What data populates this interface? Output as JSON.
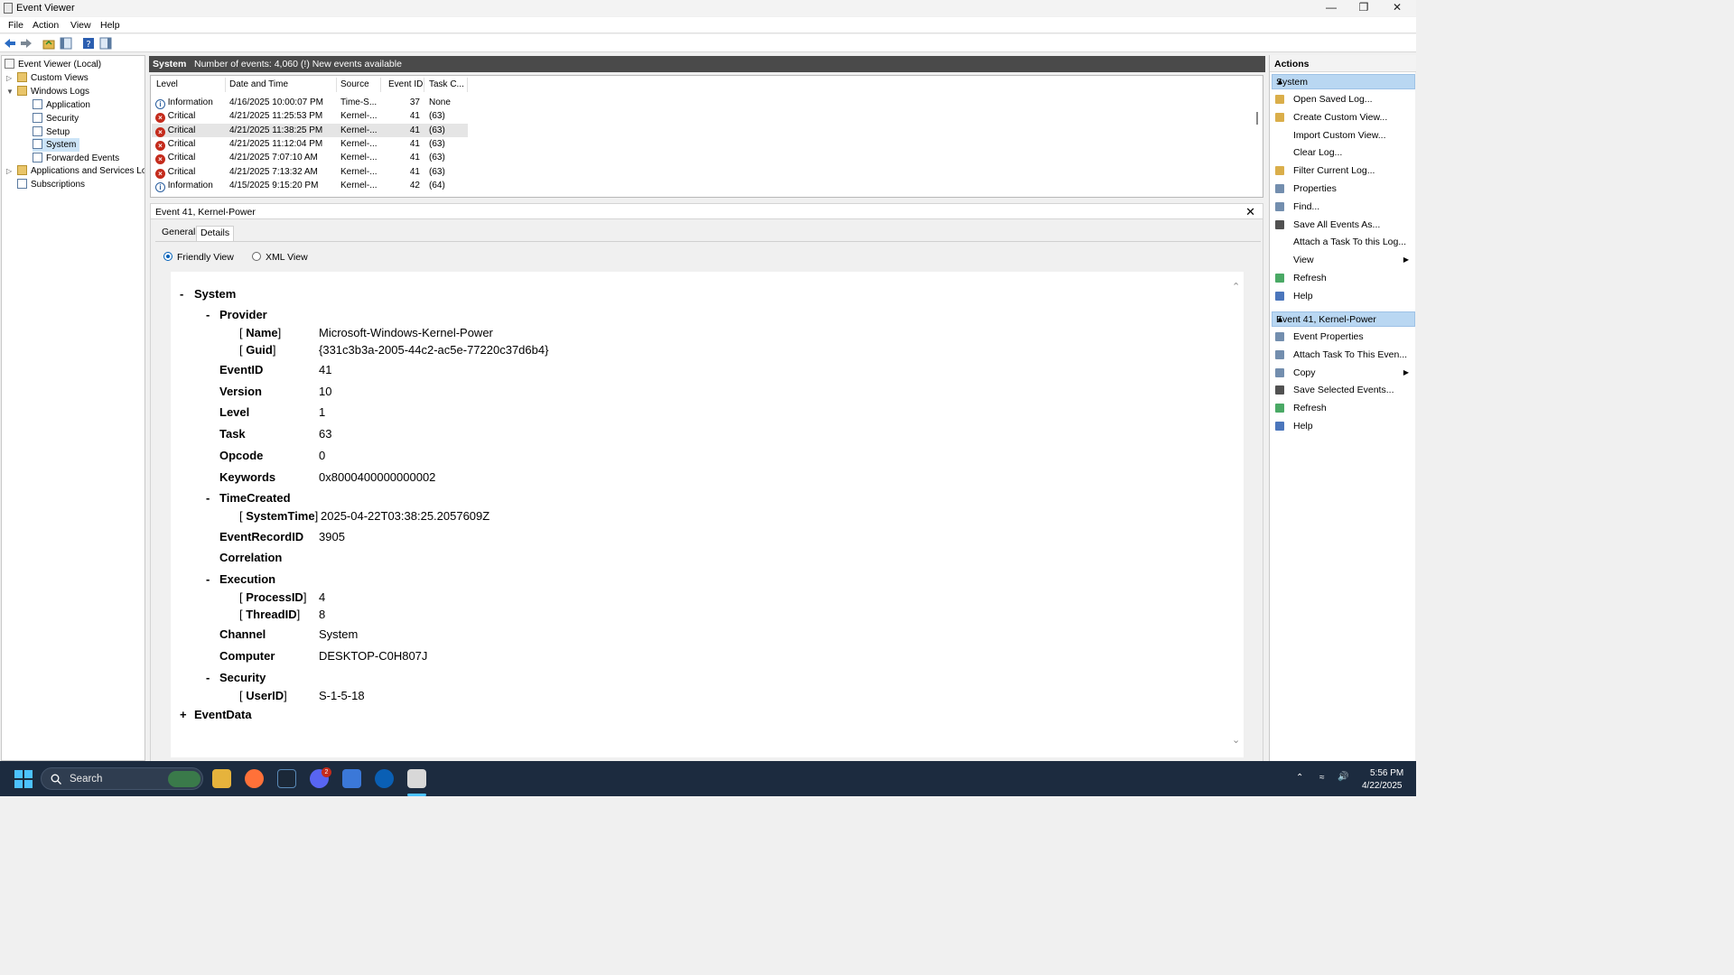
{
  "window": {
    "title": "Event Viewer",
    "controls": {
      "minimize": "—",
      "maximize": "❐",
      "close": "✕"
    }
  },
  "menu": [
    "File",
    "Action",
    "View",
    "Help"
  ],
  "tree": {
    "root": "Event Viewer (Local)",
    "custom_views": "Custom Views",
    "windows_logs": "Windows Logs",
    "logs": [
      "Application",
      "Security",
      "Setup",
      "System",
      "Forwarded Events"
    ],
    "apps_services": "Applications and Services Lo",
    "subscriptions": "Subscriptions"
  },
  "log_header": {
    "name": "System",
    "summary": "Number of events: 4,060 (!) New events available"
  },
  "events": {
    "columns": [
      "Level",
      "Date and Time",
      "Source",
      "Event ID",
      "Task C..."
    ],
    "rows": [
      {
        "level": "Information",
        "date": "4/16/2025 10:00:07 PM",
        "source": "Time-S...",
        "id": "37",
        "task": "None",
        "icon": "info-icon"
      },
      {
        "level": "Critical",
        "date": "4/21/2025 11:25:53 PM",
        "source": "Kernel-...",
        "id": "41",
        "task": "(63)",
        "icon": "critical-icon"
      },
      {
        "level": "Critical",
        "date": "4/21/2025 11:38:25 PM",
        "source": "Kernel-...",
        "id": "41",
        "task": "(63)",
        "icon": "critical-icon"
      },
      {
        "level": "Critical",
        "date": "4/21/2025 11:12:04 PM",
        "source": "Kernel-...",
        "id": "41",
        "task": "(63)",
        "icon": "critical-icon"
      },
      {
        "level": "Critical",
        "date": "4/21/2025 7:07:10 AM",
        "source": "Kernel-...",
        "id": "41",
        "task": "(63)",
        "icon": "critical-icon"
      },
      {
        "level": "Critical",
        "date": "4/21/2025 7:13:32 AM",
        "source": "Kernel-...",
        "id": "41",
        "task": "(63)",
        "icon": "critical-icon"
      },
      {
        "level": "Information",
        "date": "4/15/2025 9:15:20 PM",
        "source": "Kernel-...",
        "id": "42",
        "task": "(64)",
        "icon": "info-icon"
      }
    ]
  },
  "detail": {
    "title": "Event 41, Kernel-Power",
    "close": "✕",
    "tabs": [
      "General",
      "Details"
    ],
    "view_options": [
      "Friendly View",
      "XML View"
    ],
    "system": {
      "section": "System",
      "provider": "Provider",
      "provider_name_label": "Name",
      "provider_name": "Microsoft-Windows-Kernel-Power",
      "provider_guid_label": "Guid",
      "provider_guid": "{331c3b3a-2005-44c2-ac5e-77220c37d6b4}",
      "eventid_label": "EventID",
      "eventid": "41",
      "version_label": "Version",
      "version": "10",
      "level_label": "Level",
      "level": "1",
      "task_label": "Task",
      "task": "63",
      "opcode_label": "Opcode",
      "opcode": "0",
      "keywords_label": "Keywords",
      "keywords": "0x8000400000000002",
      "timecreated": "TimeCreated",
      "systemtime_label": "SystemTime",
      "systemtime": "2025-04-22T03:38:25.2057609Z",
      "eventrecordid_label": "EventRecordID",
      "eventrecordid": "3905",
      "correlation_label": "Correlation",
      "execution": "Execution",
      "processid_label": "ProcessID",
      "processid": "4",
      "threadid_label": "ThreadID",
      "threadid": "8",
      "channel_label": "Channel",
      "channel": "System",
      "computer_label": "Computer",
      "computer": "DESKTOP-C0H807J",
      "security": "Security",
      "userid_label": "UserID",
      "userid": "S-1-5-18"
    },
    "eventdata": "EventData",
    "toggle_minus": "-",
    "toggle_plus": "+"
  },
  "actions": {
    "header": "Actions",
    "section1": "System",
    "items1": [
      {
        "label": "Open Saved Log...",
        "icon": "open-log-icon"
      },
      {
        "label": "Create Custom View...",
        "icon": "filter-icon"
      },
      {
        "label": "Import Custom View...",
        "icon": ""
      },
      {
        "label": "Clear Log...",
        "icon": ""
      },
      {
        "label": "Filter Current Log...",
        "icon": "filter-icon"
      },
      {
        "label": "Properties",
        "icon": "properties-icon"
      },
      {
        "label": "Find...",
        "icon": "find-icon"
      },
      {
        "label": "Save All Events As...",
        "icon": "save-icon"
      },
      {
        "label": "Attach a Task To this Log...",
        "icon": ""
      },
      {
        "label": "View",
        "icon": ""
      },
      {
        "label": "Refresh",
        "icon": "refresh-icon"
      },
      {
        "label": "Help",
        "icon": "help-icon"
      }
    ],
    "section2": "Event 41, Kernel-Power",
    "items2": [
      {
        "label": "Event Properties",
        "icon": "properties-icon"
      },
      {
        "label": "Attach Task To This Even...",
        "icon": "task-icon"
      },
      {
        "label": "Copy",
        "icon": "copy-icon"
      },
      {
        "label": "Save Selected Events...",
        "icon": "save-icon"
      },
      {
        "label": "Refresh",
        "icon": "refresh-icon"
      },
      {
        "label": "Help",
        "icon": "help-icon"
      }
    ]
  },
  "taskbar": {
    "search_label": "Search",
    "time": "5:56 PM",
    "date": "4/22/2025",
    "discord_badge": "2"
  },
  "colors": {
    "accent": "#005fb8",
    "critical": "#c42b1c",
    "section_header": "#b9d7f2",
    "taskbar": "#1c2b3f"
  }
}
